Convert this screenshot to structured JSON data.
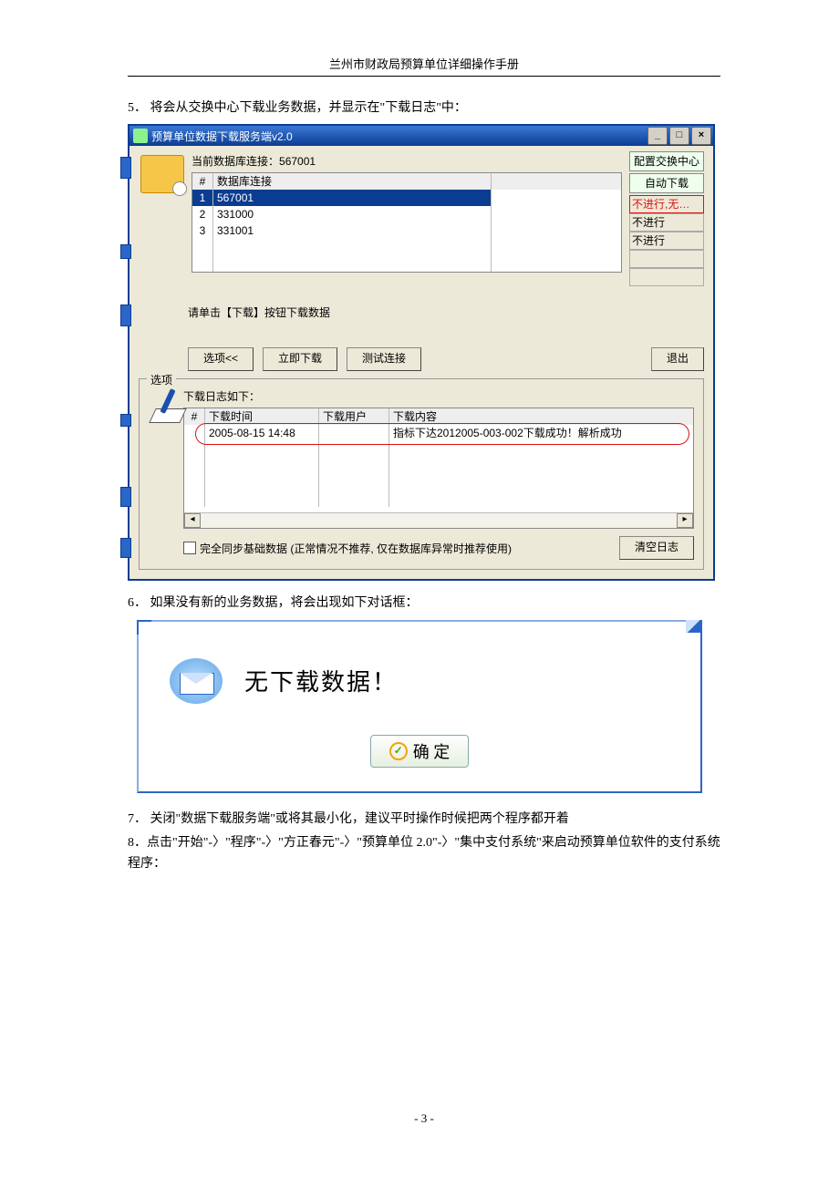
{
  "doc": {
    "header": "兰州市财政局预算单位详细操作手册",
    "page_number": "- 3 -",
    "item5": "5．  将会从交换中心下载业务数据，并显示在\"下载日志\"中：",
    "item6": "6．  如果没有新的业务数据，将会出现如下对话框：",
    "item7": "7．  关闭\"数据下载服务端\"或将其最小化，建议平时操作时候把两个程序都开着",
    "item8": "8．点击\"开始\"-〉\"程序\"-〉\"方正春元\"-〉\"预算单位 2.0\"-〉\"集中支付系统\"来启动预算单位软件的支付系统程序："
  },
  "win": {
    "title": "预算单位数据下载服务端v2.0",
    "conn_label_prefix": "当前数据库连接：",
    "conn_label_value": "567001",
    "grid_h_num": "#",
    "grid_h_db": "数据库连接",
    "rows": [
      {
        "n": "1",
        "db": "567001"
      },
      {
        "n": "2",
        "db": "331000"
      },
      {
        "n": "3",
        "db": "331001"
      }
    ],
    "flag_btn1": "配置交换中心",
    "flag_btn2": "自动下载",
    "flag1": "不进行,无…",
    "flag2": "不进行",
    "flag3": "不进行",
    "prompt": "请单击【下载】按钮下载数据",
    "btn_options": "选项<<",
    "btn_download": "立即下载",
    "btn_test": "测试连接",
    "btn_exit": "退出",
    "group_legend": "选项",
    "log_title": "下载日志如下：",
    "log_h_num": "#",
    "log_h_time": "下载时间",
    "log_h_user": "下载用户",
    "log_h_cont": "下载内容",
    "log_time": "2005-08-15 14:48",
    "log_user": "",
    "log_cont": "指标下达2012005-003-002下载成功！解析成功",
    "chk_label": "完全同步基础数据 (正常情况不推荐, 仅在数据库异常时推荐使用)",
    "btn_clear": "清空日志"
  },
  "dlg": {
    "message": "无下载数据！",
    "ok": "确 定"
  }
}
